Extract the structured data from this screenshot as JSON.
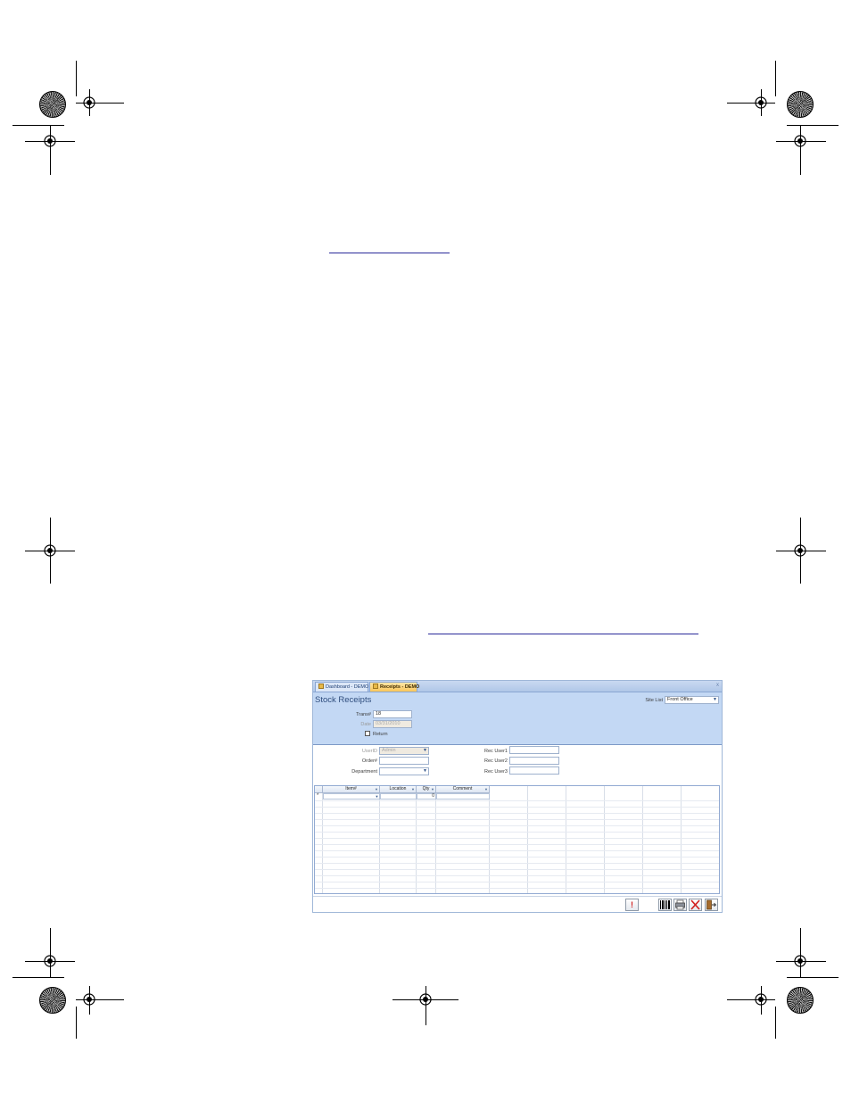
{
  "window": {
    "tabs": [
      {
        "label": "Dashboard - DEMO"
      },
      {
        "label": "Receipts - DEMO"
      }
    ],
    "close_glyph": "x"
  },
  "form": {
    "title": "Stock Receipts",
    "trans_label": "Trans#",
    "trans_value": "18",
    "date_label": "Date",
    "date_value": "03/31/2010",
    "return_label": "Return",
    "return_checked": false,
    "site_list_label": "Site List",
    "site_list_value": "Front Office",
    "userid_label": "UserID",
    "userid_value": "Admin",
    "order_label": "Order#",
    "order_value": "",
    "department_label": "Department",
    "department_value": "",
    "rec_user1_label": "Rec User1",
    "rec_user2_label": "Rec User2",
    "rec_user3_label": "Rec User3"
  },
  "grid": {
    "columns": [
      "Item#",
      "Location",
      "Qty",
      "Comment"
    ],
    "new_row_marker": "*",
    "new_row_qty": "0"
  },
  "toolbar": {
    "icons": [
      "alert-icon",
      "barcode-icon",
      "print-icon",
      "delete-icon",
      "exit-icon"
    ]
  },
  "colors": {
    "header_bg": "#c3d8f4",
    "active_tab": "#f8c65a",
    "delete_red": "#d21f1f"
  }
}
